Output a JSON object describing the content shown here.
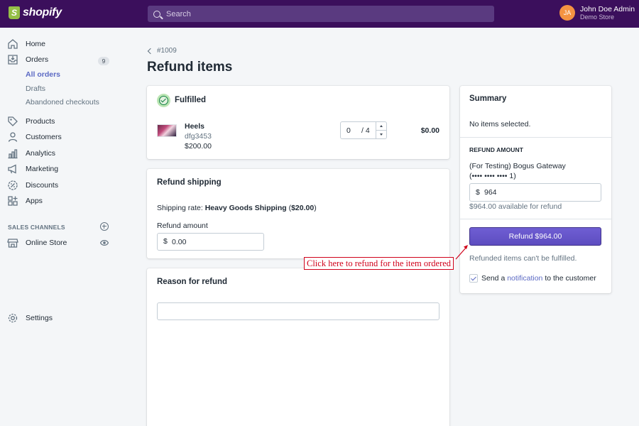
{
  "topbar": {
    "brand": "shopify",
    "search_placeholder": "Search",
    "user": {
      "initials": "JA",
      "name": "John Doe Admin",
      "store": "Demo Store"
    }
  },
  "sidebar": {
    "items": [
      {
        "label": "Home",
        "icon": "home-icon"
      },
      {
        "label": "Orders",
        "icon": "orders-icon",
        "badge": "9"
      },
      {
        "label": "Products",
        "icon": "tag-icon"
      },
      {
        "label": "Customers",
        "icon": "person-icon"
      },
      {
        "label": "Analytics",
        "icon": "bar-chart-icon"
      },
      {
        "label": "Marketing",
        "icon": "megaphone-icon"
      },
      {
        "label": "Discounts",
        "icon": "discount-icon"
      },
      {
        "label": "Apps",
        "icon": "apps-icon"
      }
    ],
    "orders_sub": [
      {
        "label": "All orders",
        "active": true
      },
      {
        "label": "Drafts"
      },
      {
        "label": "Abandoned checkouts"
      }
    ],
    "sales_channels_label": "SALES CHANNELS",
    "online_store_label": "Online Store",
    "settings_label": "Settings"
  },
  "main": {
    "back_label": "#1009",
    "title": "Refund items",
    "fulfilled": {
      "title": "Fulfilled",
      "item": {
        "name": "Heels",
        "sku": "dfg3453",
        "price": "$200.00",
        "qty": "0",
        "qty_of": "/ 4",
        "total": "$0.00"
      }
    },
    "shipping": {
      "title": "Refund shipping",
      "rate_prefix": "Shipping rate: ",
      "rate_name": "Heavy Goods Shipping",
      "rate_open": " (",
      "rate_amount": "$20.00",
      "rate_close": ")",
      "amount_label": "Refund amount",
      "currency": "$",
      "amount_value": "0.00"
    },
    "reason": {
      "title": "Reason for refund",
      "value": ""
    }
  },
  "summary": {
    "title": "Summary",
    "no_items": "No items selected.",
    "refund_amount_label": "REFUND AMOUNT",
    "gateway": "(For Testing) Bogus Gateway",
    "card": "(•••• •••• •••• 1)",
    "currency": "$",
    "amount_value": "964",
    "available": "$964.00 available for refund",
    "refund_button": "Refund $964.00",
    "note": "Refunded items can't be fulfilled.",
    "send_prefix": "Send a ",
    "send_link": "notification",
    "send_suffix": " to the customer"
  },
  "annotation": {
    "text": "Click here to refund for the item ordered",
    "color": "#d0021b"
  },
  "colors": {
    "topbar": "#3b0f5c",
    "accent": "#5c6ac4",
    "button": "#5d4dc0",
    "success": "#108043"
  }
}
